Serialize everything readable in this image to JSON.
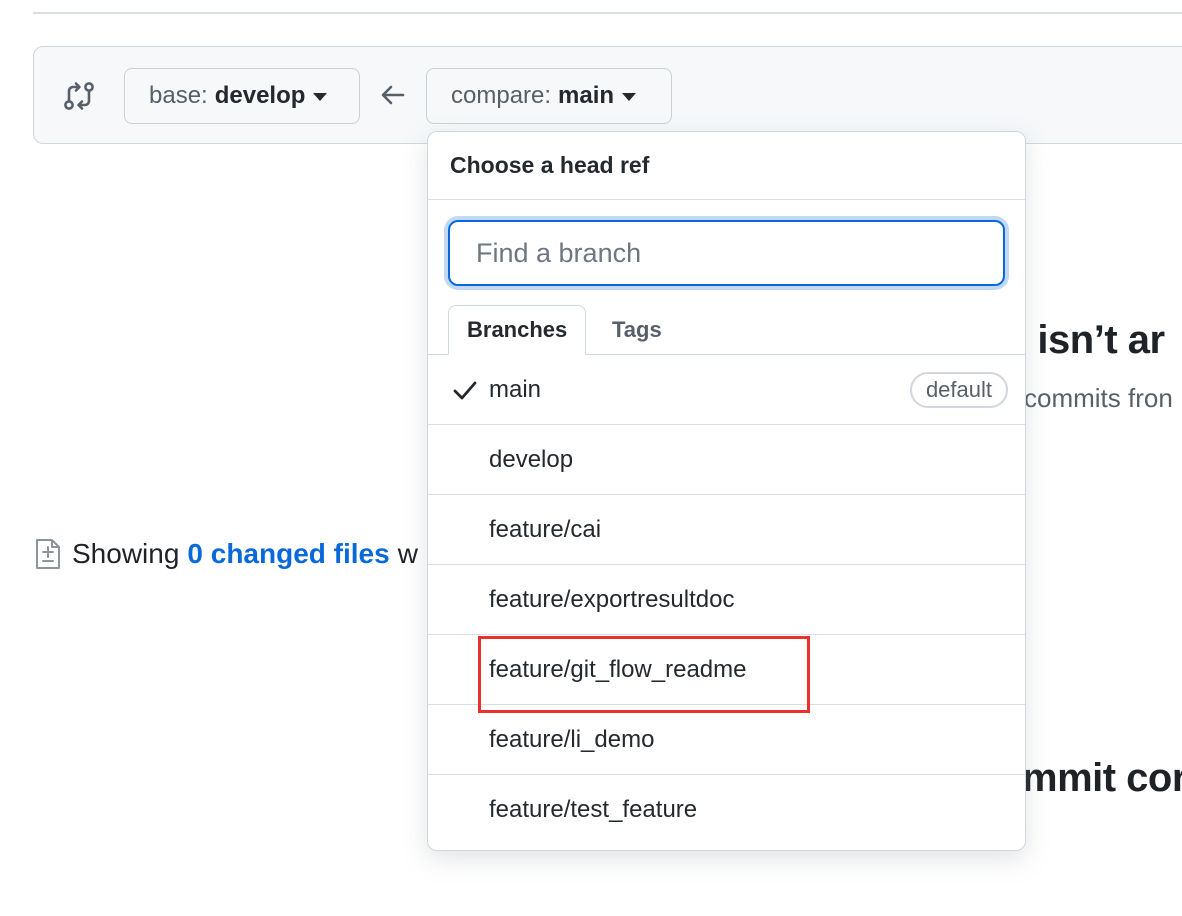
{
  "range_bar": {
    "base_label": "base:",
    "base_value": "develop",
    "compare_label": "compare:",
    "compare_value": "main"
  },
  "background": {
    "heading_1": "re isn’t ar",
    "sub_1": "commits fron",
    "heading_2": "mmit cor",
    "files_prefix": "Showing",
    "files_link": "0 changed files",
    "files_suffix": "w"
  },
  "dropdown": {
    "title": "Choose a head ref",
    "filter_placeholder": "Find a branch",
    "tabs": [
      {
        "label": "Branches",
        "active": true
      },
      {
        "label": "Tags",
        "active": false
      }
    ],
    "branches": [
      {
        "name": "main",
        "selected": true,
        "badge": "default"
      },
      {
        "name": "develop"
      },
      {
        "name": "feature/cai"
      },
      {
        "name": "feature/exportresultdoc"
      },
      {
        "name": "feature/git_flow_readme",
        "highlighted": true
      },
      {
        "name": "feature/li_demo"
      },
      {
        "name": "feature/test_feature"
      }
    ]
  },
  "colors": {
    "accent": "#0969da",
    "highlight_box": "#e8312c"
  }
}
